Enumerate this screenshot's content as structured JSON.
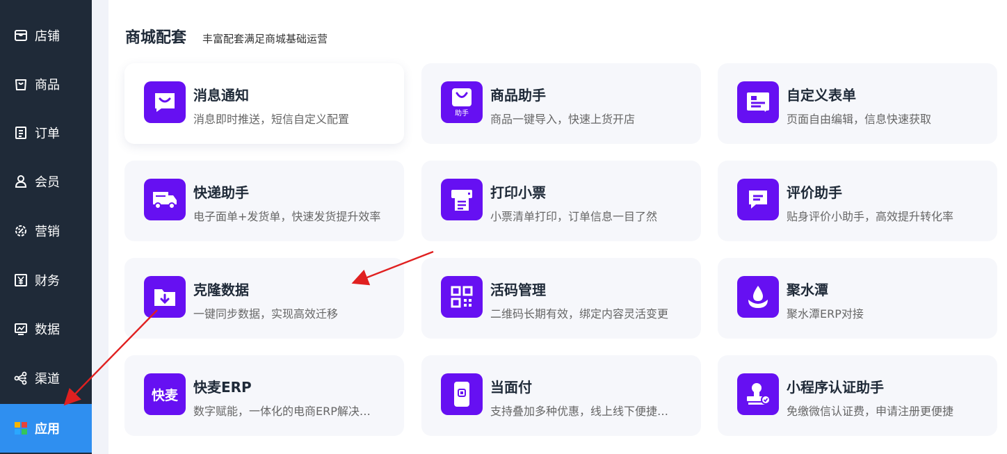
{
  "sidebar": {
    "items": [
      {
        "label": "店铺",
        "icon": "shop-icon"
      },
      {
        "label": "商品",
        "icon": "bag-icon"
      },
      {
        "label": "订单",
        "icon": "order-icon"
      },
      {
        "label": "会员",
        "icon": "user-icon"
      },
      {
        "label": "营销",
        "icon": "marketing-icon"
      },
      {
        "label": "财务",
        "icon": "finance-icon"
      },
      {
        "label": "数据",
        "icon": "chart-icon"
      },
      {
        "label": "渠道",
        "icon": "share-icon"
      },
      {
        "label": "应用",
        "icon": "apps-icon",
        "active": true
      }
    ]
  },
  "section": {
    "title": "商城配套",
    "subtitle": "丰富配套满足商城基础运营"
  },
  "cards": [
    {
      "title": "消息通知",
      "desc": "消息即时推送，短信自定义配置",
      "icon": "message-icon"
    },
    {
      "title": "商品助手",
      "desc": "商品一键导入，快速上货开店",
      "icon": "product-helper-icon",
      "icon_text": "助手"
    },
    {
      "title": "自定义表单",
      "desc": "页面自由编辑，信息快速获取",
      "icon": "form-icon"
    },
    {
      "title": "快递助手",
      "desc": "电子面单+发货单，快速发货提升效率",
      "icon": "truck-icon"
    },
    {
      "title": "打印小票",
      "desc": "小票清单打印，订单信息一目了然",
      "icon": "printer-icon"
    },
    {
      "title": "评价助手",
      "desc": "贴身评价小助手，高效提升转化率",
      "icon": "comment-icon"
    },
    {
      "title": "克隆数据",
      "desc": "一键同步数据，实现高效迁移",
      "icon": "clone-folder-icon"
    },
    {
      "title": "活码管理",
      "desc": "二维码长期有效，绑定内容灵活变更",
      "icon": "qrcode-icon"
    },
    {
      "title": "聚水潭",
      "desc": "聚水潭ERP对接",
      "icon": "water-drop-icon"
    },
    {
      "title": "快麦ERP",
      "desc": "数字赋能，一体化的电商ERP解决方案",
      "icon": "kuaimai-logo-icon",
      "icon_text": "快麦"
    },
    {
      "title": "当面付",
      "desc": "支持叠加多种优惠，线上线下便捷收款",
      "icon": "phone-pay-icon"
    },
    {
      "title": "小程序认证助手",
      "desc": "免缴微信认证费，申请注册更便捷",
      "icon": "stamp-icon"
    }
  ],
  "colors": {
    "sidebar_bg": "#1f2a38",
    "active_bg": "#2f8ff0",
    "icon_bg": "#6610f2",
    "card_bg": "#f6f7fb",
    "arrow": "#e02020"
  }
}
